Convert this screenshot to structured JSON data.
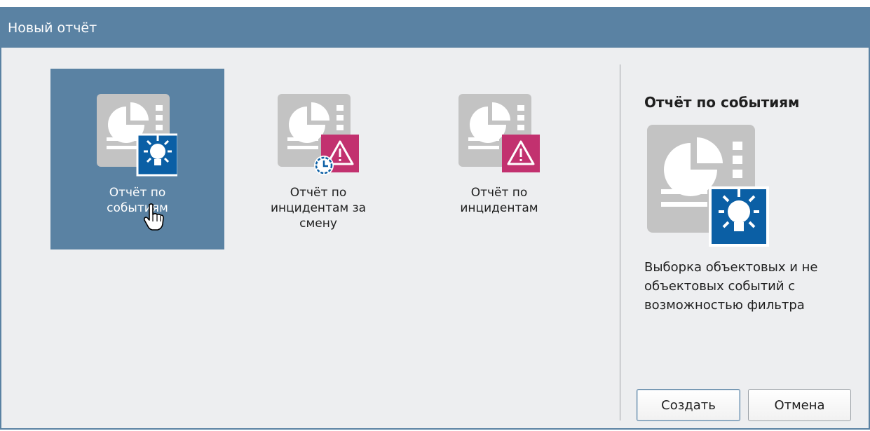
{
  "dialog": {
    "title": "Новый отчёт"
  },
  "report_types": [
    {
      "label": "Отчёт по\nсобытиям",
      "selected": true,
      "badge": "lightbulb-icon",
      "badge_color": "#0b5fa5"
    },
    {
      "label": "Отчёт по\nинцидентам за\nсмену",
      "selected": false,
      "badge": "warning-clock-icon",
      "badge_color": "#c2316f"
    },
    {
      "label": "Отчёт по\nинцидентам",
      "selected": false,
      "badge": "warning-icon",
      "badge_color": "#c2316f"
    }
  ],
  "details": {
    "title": "Отчёт по событиям",
    "description": "Выборка объектовых и не\nобъектовых событий с\nвозможностью фильтра"
  },
  "buttons": {
    "create": "Создать",
    "cancel": "Отмена"
  },
  "colors": {
    "accent": "#5a82a3",
    "event_badge": "#0b5fa5",
    "incident_badge": "#c2316f"
  }
}
